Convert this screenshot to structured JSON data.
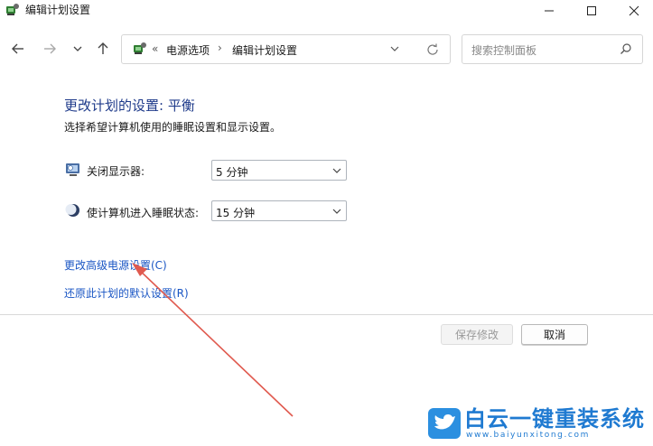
{
  "window": {
    "title": "编辑计划设置"
  },
  "nav": {
    "back_icon": "arrow-left-icon",
    "forward_icon": "arrow-right-icon",
    "recent_icon": "chevron-down-icon",
    "up_icon": "arrow-up-icon"
  },
  "address": {
    "chevron": "«",
    "segment1": "电源选项",
    "separator": "›",
    "segment2": "编辑计划设置"
  },
  "search": {
    "placeholder": "搜索控制面板"
  },
  "main": {
    "heading": "更改计划的设置: 平衡",
    "subtitle": "选择希望计算机使用的睡眠设置和显示设置。",
    "display_label": "关闭显示器:",
    "display_value": "5 分钟",
    "sleep_label": "使计算机进入睡眠状态:",
    "sleep_value": "15 分钟",
    "advanced_link": "更改高级电源设置(C)",
    "restore_link": "还原此计划的默认设置(R)"
  },
  "buttons": {
    "save": "保存修改",
    "cancel": "取消"
  },
  "watermark": {
    "title": "白云一键重装系统",
    "url": "www.baiyunxitong.com"
  },
  "colors": {
    "heading": "#1e3a8a",
    "link": "#1a56c4",
    "annotation_arrow": "#e05a4f",
    "watermark": "#1f7ad1"
  }
}
